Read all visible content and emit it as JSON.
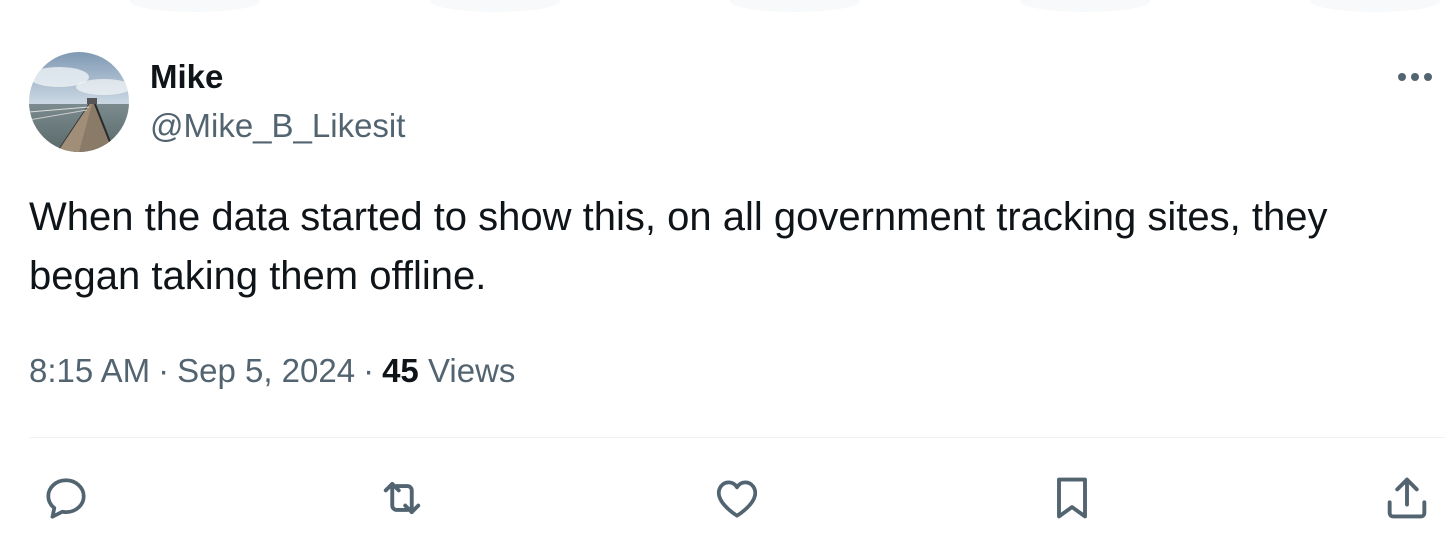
{
  "author": {
    "display_name": "Mike",
    "handle": "@Mike_B_Likesit",
    "avatar_icon": "pier-photo-avatar"
  },
  "tweet": {
    "text": "When the data started to show this, on all government tracking sites, they began taking them offline.",
    "time": "8:15 AM",
    "separator": "·",
    "date": "Sep 5, 2024",
    "views_count": "45",
    "views_label": "Views"
  },
  "actions": [
    {
      "name": "reply",
      "icon": "speech-bubble-icon"
    },
    {
      "name": "retweet",
      "icon": "repost-arrows-icon"
    },
    {
      "name": "like",
      "icon": "heart-icon"
    },
    {
      "name": "bookmark",
      "icon": "bookmark-icon"
    },
    {
      "name": "share",
      "icon": "share-upload-icon"
    }
  ],
  "colors": {
    "text_primary": "#0f1419",
    "text_secondary": "#536471",
    "divider": "#eff3f4",
    "icon": "#536471"
  }
}
